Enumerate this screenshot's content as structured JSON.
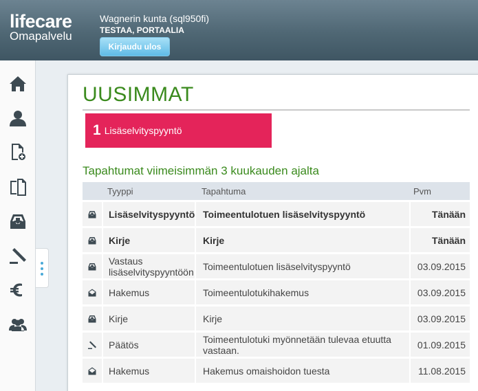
{
  "header": {
    "logo_main": "lifecare",
    "logo_sub": "Omapalvelu",
    "organization": "Wagnerin kunta (sql950fi)",
    "user_name": "TESTAA, PORTAALIA",
    "logout_label": "Kirjaudu ulos"
  },
  "sidebar": {
    "items": [
      {
        "icon": "home-icon"
      },
      {
        "icon": "user-icon"
      },
      {
        "icon": "new-document-icon"
      },
      {
        "icon": "documents-icon"
      },
      {
        "icon": "inbox-icon"
      },
      {
        "icon": "gavel-icon"
      },
      {
        "icon": "euro-icon"
      },
      {
        "icon": "group-icon"
      }
    ]
  },
  "main": {
    "title": "UUSIMMAT",
    "alert": {
      "count": "1",
      "label": "Lisäselvityspyyntö"
    },
    "section_title": "Tapahtumat viimeisimmän 3 kuukauden ajalta",
    "table": {
      "headers": {
        "type": "Tyyppi",
        "event": "Tapahtuma",
        "date": "Pvm"
      },
      "rows": [
        {
          "icon": "inbox-icon",
          "type": "Lisäselvityspyyntö",
          "event": "Toimeentulotuen lisäselvityspyyntö",
          "date": "Tänään",
          "bold": true
        },
        {
          "icon": "inbox-icon",
          "type": "Kirje",
          "event": "Kirje",
          "date": "Tänään",
          "bold": true
        },
        {
          "icon": "inbox-icon",
          "type": "Vastaus lisäselvityspyyntöön",
          "event": "Toimeentulotuen lisäselvityspyyntö",
          "date": "03.09.2015",
          "bold": false
        },
        {
          "icon": "open-envelope-icon",
          "type": "Hakemus",
          "event": "Toimeentulotukihakemus",
          "date": "03.09.2015",
          "bold": false
        },
        {
          "icon": "inbox-icon",
          "type": "Kirje",
          "event": "Kirje",
          "date": "03.09.2015",
          "bold": false
        },
        {
          "icon": "gavel-icon",
          "type": "Päätös",
          "event": "Toimeentulotuki myönnetään tulevaa etuutta vastaan.",
          "date": "01.09.2015",
          "bold": false
        },
        {
          "icon": "open-envelope-icon",
          "type": "Hakemus",
          "event": "Hakemus omaishoidon tuesta",
          "date": "11.08.2015",
          "bold": false
        }
      ]
    }
  }
}
